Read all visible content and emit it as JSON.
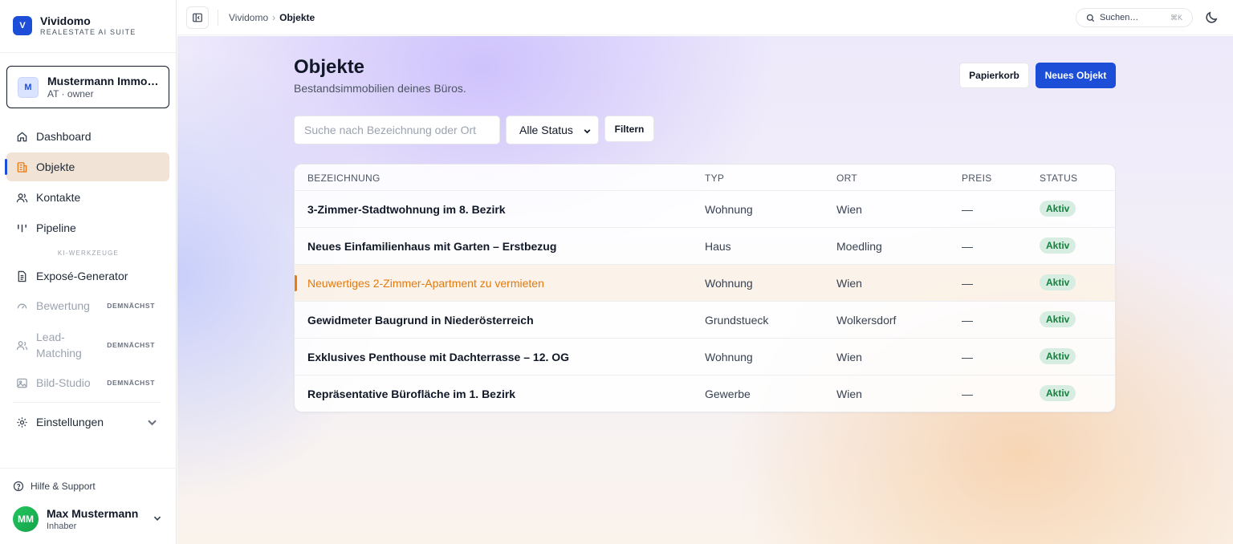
{
  "brand": {
    "logo_letter": "V",
    "name": "Vividomo",
    "subtitle": "REALESTATE AI SUITE",
    "accent": "#1d4ed8"
  },
  "org": {
    "avatar": "M",
    "name": "Mustermann Immob…",
    "meta": "AT · owner"
  },
  "nav": {
    "dashboard": "Dashboard",
    "objekte": "Objekte",
    "kontakte": "Kontakte",
    "pipeline": "Pipeline",
    "section_ki": "KI-WERKZEUGE",
    "expose": "Exposé-Generator",
    "bewertung": "Bewertung",
    "lead_matching_1": "Lead-",
    "lead_matching_2": "Matching",
    "bild_studio": "Bild-Studio",
    "soon": "DEMNÄCHST",
    "einstellungen": "Einstellungen"
  },
  "help": "Hilfe & Support",
  "user": {
    "initials": "MM",
    "name": "Max Mustermann",
    "role": "Inhaber"
  },
  "topbar": {
    "breadcrumb_root": "Vividomo",
    "breadcrumb_sep": "›",
    "breadcrumb_current": "Objekte",
    "search_label": "Suchen…",
    "search_shortcut": "⌘K"
  },
  "page": {
    "title": "Objekte",
    "subtitle": "Bestandsimmobilien deines Büros.",
    "trash_button": "Papierkorb",
    "new_button": "Neues Objekt"
  },
  "filters": {
    "search_placeholder": "Suche nach Bezeichnung oder Ort",
    "status_value": "Alle Status",
    "filter_button": "Filtern"
  },
  "table": {
    "headers": {
      "name": "BEZEICHNUNG",
      "type": "TYP",
      "place": "ORT",
      "price": "PREIS",
      "status": "STATUS"
    },
    "rows": [
      {
        "name": "3-Zimmer-Stadtwohnung im 8. Bezirk",
        "type": "Wohnung",
        "place": "Wien",
        "price": "—",
        "status": "Aktiv"
      },
      {
        "name": "Neues Einfamilienhaus mit Garten – Erstbezug",
        "type": "Haus",
        "place": "Moedling",
        "price": "—",
        "status": "Aktiv"
      },
      {
        "name": "Neuwertiges 2-Zimmer-Apartment zu vermieten",
        "type": "Wohnung",
        "place": "Wien",
        "price": "—",
        "status": "Aktiv"
      },
      {
        "name": "Gewidmeter Baugrund in Niederösterreich",
        "type": "Grundstueck",
        "place": "Wolkersdorf",
        "price": "—",
        "status": "Aktiv"
      },
      {
        "name": "Exklusives Penthouse mit Dachterrasse – 12. OG",
        "type": "Wohnung",
        "place": "Wien",
        "price": "—",
        "status": "Aktiv"
      },
      {
        "name": "Repräsentative Bürofläche im 1. Bezirk",
        "type": "Gewerbe",
        "place": "Wien",
        "price": "—",
        "status": "Aktiv"
      }
    ]
  },
  "colors": {
    "primary": "#1d4ed8",
    "active_nav_bg": "#f1e4d6",
    "hover_row_text": "#e07a10",
    "badge_bg": "#d7ede1",
    "badge_text": "#15803d"
  },
  "icons": [
    "home-icon",
    "building-icon",
    "users-icon",
    "pipeline-icon",
    "document-icon",
    "gauge-icon",
    "user-match-icon",
    "image-icon",
    "gear-icon",
    "help-icon",
    "search-icon",
    "moon-icon",
    "sidebar-toggle-icon",
    "chevron-down-icon"
  ]
}
